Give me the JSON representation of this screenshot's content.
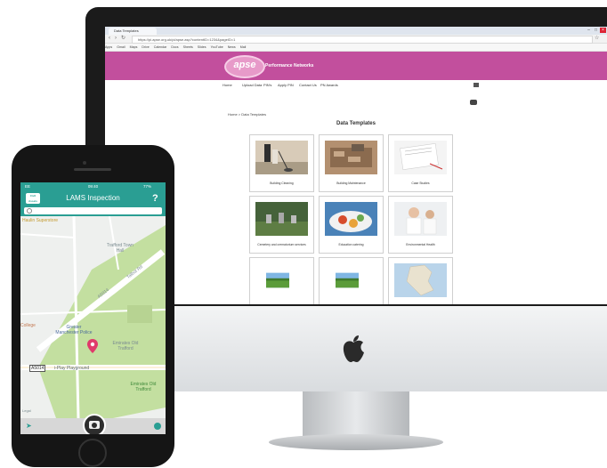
{
  "browser": {
    "tab_title": "Data Templates",
    "url": "https://pi.apse.org.uk/pi/apse.asp?contentID=1234&pageID=1",
    "bookmarks": [
      "Apps",
      "Gmail",
      "Maps",
      "Drive",
      "Calendar",
      "Docs",
      "Sheets",
      "Slides",
      "YouTube",
      "News",
      "Mail"
    ]
  },
  "site": {
    "logo_text": "apse",
    "subtitle": "Performance Networks",
    "nav": [
      "Home",
      "Upload Data",
      "PIN's",
      "Apply PIN",
      "Contact Us",
      "PN Awards"
    ],
    "breadcrumb": "Home > Data Templates",
    "page_title": "Data Templates",
    "tiles": [
      {
        "caption": "Building Cleaning"
      },
      {
        "caption": "Building Maintenance"
      },
      {
        "caption": "Case Studies"
      },
      {
        "caption": "Cemetery and crematorium services"
      },
      {
        "caption": "Education catering"
      },
      {
        "caption": "Environmental Health"
      },
      {
        "caption": ""
      },
      {
        "caption": ""
      },
      {
        "caption": ""
      }
    ]
  },
  "phone": {
    "status_left": "EE",
    "status_time": "09:40",
    "status_right": "77%",
    "app_logo": "Civil Assets",
    "app_title": "LAMS Inspection",
    "help": "?",
    "map_labels": {
      "top": "Haulin Superstore",
      "trafford_town_hall": "Trafford Town Hall",
      "talbot_rd": "Talbot Rd",
      "a5014": "A5014",
      "college": "College",
      "police": "Greater Manchester Police",
      "emirates_district": "Emirates Old Trafford",
      "road_sign": "A5014",
      "playground": "i-Play Playground",
      "emirates": "Emirates Old Trafford",
      "legal": "Legal"
    }
  },
  "colors": {
    "apse_magenta": "#c24f9d",
    "app_teal": "#2a9e93",
    "map_green": "#c3dfa0",
    "pin_red": "#e03a6b"
  }
}
